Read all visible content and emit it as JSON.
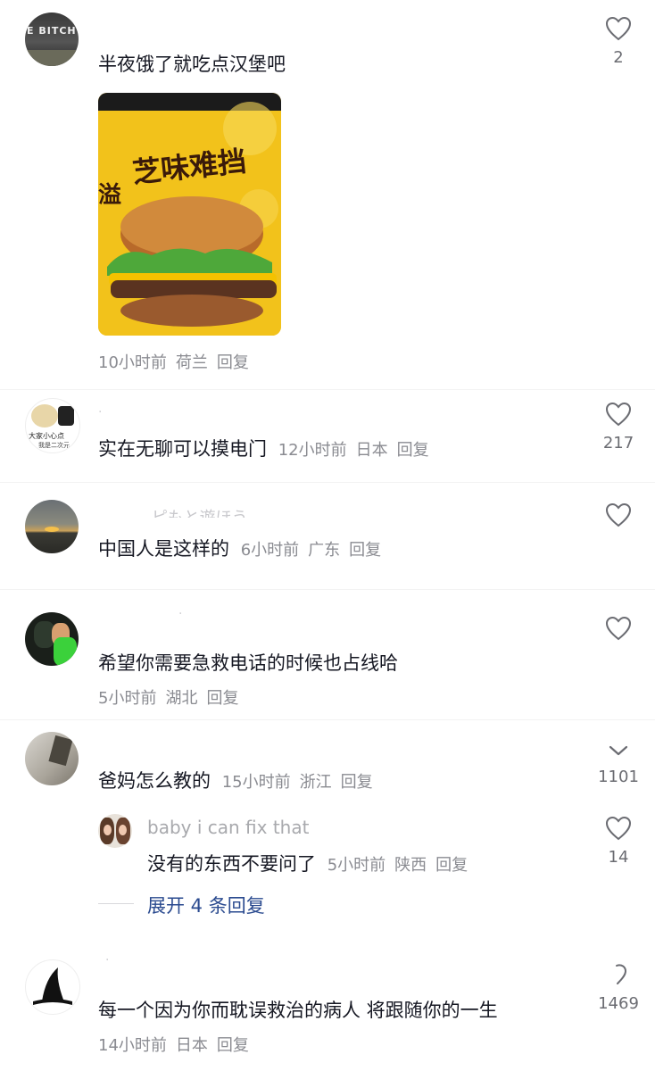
{
  "comments": [
    {
      "text": "半夜饿了就吃点汉堡吧",
      "time": "10小时前",
      "location": "荷兰",
      "reply": "回复",
      "likes": "2",
      "avatar_text": "E BITCH",
      "image": {
        "headline": "芝味难挡",
        "side": "溢"
      }
    },
    {
      "text": "实在无聊可以摸电门",
      "time": "12小时前",
      "location": "日本",
      "reply": "回复",
      "likes": "217",
      "avatar_text_1": "大家小心点",
      "avatar_text_2": "我是二次元"
    },
    {
      "name": "ピもと遊ほう",
      "text": "中国人是这样的",
      "time": "6小时前",
      "location": "广东",
      "reply": "回复",
      "likes": ""
    },
    {
      "text": "希望你需要急救电话的时候也占线哈",
      "time": "5小时前",
      "location": "湖北",
      "reply": "回复",
      "likes": ""
    },
    {
      "text": "爸妈怎么教的",
      "time": "15小时前",
      "location": "浙江",
      "reply": "回复",
      "likes": "1101",
      "reply_item": {
        "name": "baby i can fix that",
        "text": "没有的东西不要问了",
        "time": "5小时前",
        "location": "陕西",
        "reply": "回复",
        "likes": "14"
      },
      "expand_label": "展开 4 条回复"
    },
    {
      "text": "每一个因为你而耽误救治的病人 将跟随你的一生",
      "time": "14小时前",
      "location": "日本",
      "reply": "回复",
      "likes": "1469"
    }
  ],
  "icons": [
    "heart-outline-icon",
    "chevron-down-icon"
  ],
  "colors": {
    "text": "#161823",
    "meta": "#8a8b91",
    "link": "#2a4a8f",
    "burger_bg": "#f2c21b"
  }
}
